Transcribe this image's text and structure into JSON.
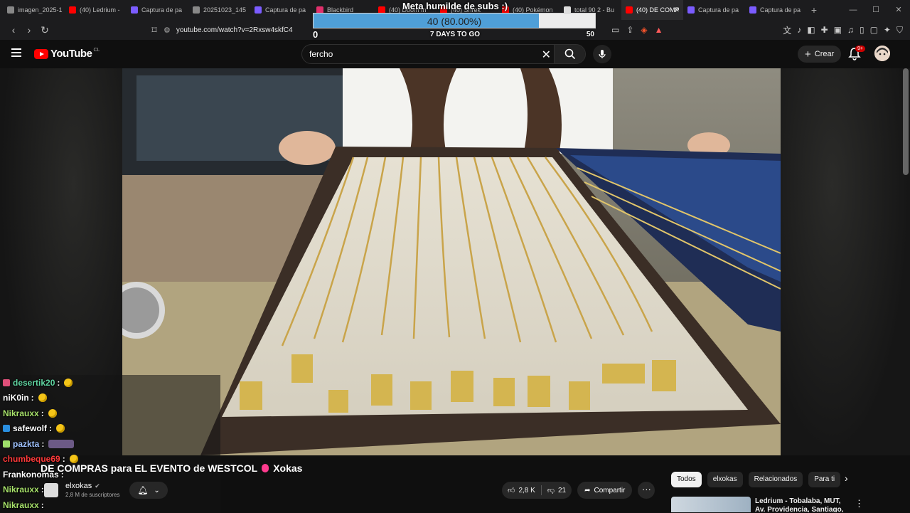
{
  "browser": {
    "tabs": [
      {
        "label": "imagen_2025-1",
        "color": "#888888"
      },
      {
        "label": "(40) Ledrium -",
        "color": "#ff0000"
      },
      {
        "label": "Captura de pa",
        "color": "#7b5cff"
      },
      {
        "label": "20251023_145",
        "color": "#888888"
      },
      {
        "label": "Captura de pa",
        "color": "#7b5cff"
      },
      {
        "label": "Blackbird",
        "color": "#e1306c"
      },
      {
        "label": "(40) Doom In",
        "color": "#ff0000"
      },
      {
        "label": "(40) Shrek",
        "color": "#ff0000"
      },
      {
        "label": "(40) Pokémon",
        "color": "#ff0000"
      },
      {
        "label": "total 90 2 - Bu",
        "color": "#dddddd"
      },
      {
        "label": "(40) DE COMP",
        "color": "#ff0000",
        "active": true
      },
      {
        "label": "Captura de pa",
        "color": "#7b5cff"
      },
      {
        "label": "Captura de pa",
        "color": "#7b5cff"
      }
    ],
    "url": "youtube.com/watch?v=2Rxsw4skfC4"
  },
  "goal": {
    "title": "Meta humilde de subs :)",
    "progress_text": "40 (80.00%)",
    "progress": 0.8,
    "min": "0",
    "max": "50",
    "days": "7 DAYS TO GO"
  },
  "youtube": {
    "logo_text": "YouTube",
    "country": "CL",
    "search_value": "fercho",
    "create_label": "Crear",
    "notif_badge": "9+"
  },
  "video": {
    "title": "DE COMPRAS para EL EVENTO de WESTCOL",
    "title_suffix": "Xokas",
    "channel_name": "elxokas",
    "subscribers": "2,8 M de suscriptores",
    "likes": "2,8 K",
    "dislikes": "21",
    "share_label": "Compartir"
  },
  "chat": [
    {
      "user": "desertik20",
      "color": "#5fd3a0",
      "badge": "#e0507a",
      "emote": "face"
    },
    {
      "user": "niK0in",
      "color": "#ffffff",
      "badge": "",
      "emote": "face"
    },
    {
      "user": "Nikrauxx",
      "color": "#a8e26b",
      "badge": "",
      "emote": "face"
    },
    {
      "user": "safewolf",
      "color": "#ffffff",
      "badge": "#2a8fe0",
      "emote": "face"
    },
    {
      "user": "pazkta",
      "color": "#9fc2ff",
      "badge": "#9fe06b",
      "emote": "wide"
    },
    {
      "user": "chumbeque69",
      "color": "#ff3a3a",
      "badge": "",
      "emote": "face"
    },
    {
      "user": "Frankonomas",
      "color": "#ffffff",
      "badge": "",
      "emote": ""
    },
    {
      "user": "Nikrauxx",
      "color": "#a8e26b",
      "badge": "",
      "emote": ""
    },
    {
      "user": "Nikrauxx",
      "color": "#a8e26b",
      "badge": "",
      "emote": ""
    }
  ],
  "chips": [
    "Todos",
    "elxokas",
    "Relacionados",
    "Para ti"
  ],
  "recommendation": {
    "title": "Ledrium - Tobalaba, MUT, Av. Providencia, Santiago, Chile"
  }
}
